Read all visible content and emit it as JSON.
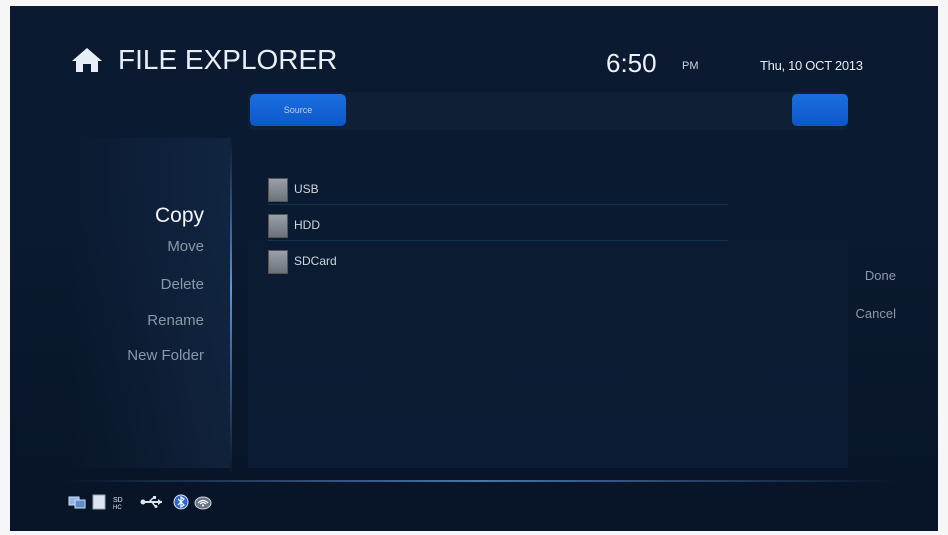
{
  "header": {
    "title": "FILE EXPLORER",
    "time": "6:50",
    "ampm": "PM",
    "date": "Thu, 10 OCT 2013"
  },
  "source_bar": {
    "tab_label": "Source"
  },
  "files": [
    {
      "label": "USB",
      "icon": "drive-icon"
    },
    {
      "label": "HDD",
      "icon": "drive-icon"
    },
    {
      "label": "SDCard",
      "icon": "drive-icon"
    }
  ],
  "menu": {
    "items": [
      {
        "label": "Copy",
        "active": true
      },
      {
        "label": "Move",
        "active": false
      },
      {
        "label": "Delete",
        "active": false
      },
      {
        "label": "Rename",
        "active": false
      },
      {
        "label": "New Folder",
        "active": false
      }
    ]
  },
  "actions": {
    "done": "Done",
    "cancel": "Cancel"
  },
  "status_icons": [
    "network-icon",
    "storage-icon",
    "sdhc-icon",
    "usb-icon",
    "bluetooth-icon",
    "wifi-icon"
  ],
  "colors": {
    "accent": "#1a6fe0",
    "background": "#0a1a31",
    "text": "#e8eef6",
    "muted": "#8a98aa"
  }
}
